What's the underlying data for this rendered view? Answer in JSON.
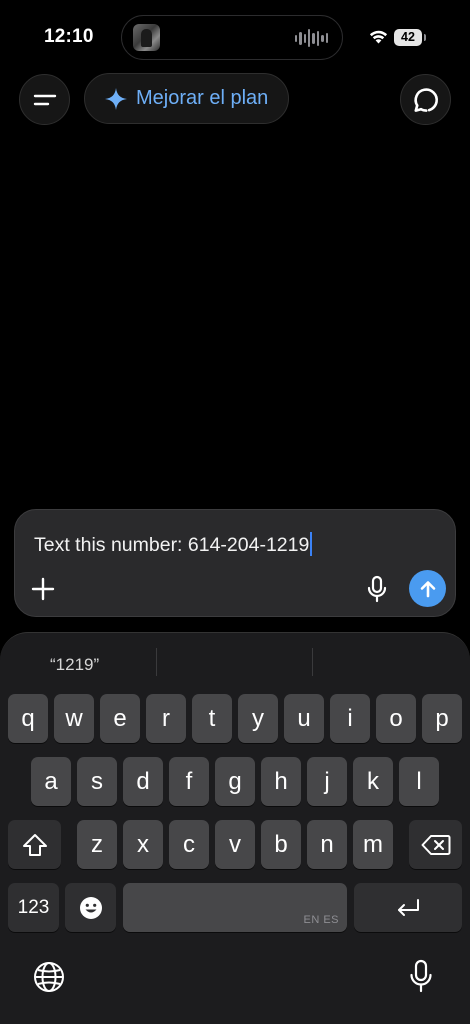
{
  "status_bar": {
    "time": "12:10",
    "battery": "42"
  },
  "top_nav": {
    "upgrade_label": "Mejorar el plan"
  },
  "composer": {
    "text": "Text this number: 614-204-1219"
  },
  "keyboard": {
    "suggestions": [
      "“1219”",
      "",
      ""
    ],
    "rows": [
      [
        "q",
        "w",
        "e",
        "r",
        "t",
        "y",
        "u",
        "i",
        "o",
        "p"
      ],
      [
        "a",
        "s",
        "d",
        "f",
        "g",
        "h",
        "j",
        "k",
        "l"
      ],
      [
        "z",
        "x",
        "c",
        "v",
        "b",
        "n",
        "m"
      ]
    ],
    "numbers_key": "123",
    "space_languages": "EN ES"
  },
  "colors": {
    "accent": "#4a9bf0",
    "upgrade_text": "#6eaff7",
    "key": "#474749",
    "key_dark": "#2f2f31"
  }
}
